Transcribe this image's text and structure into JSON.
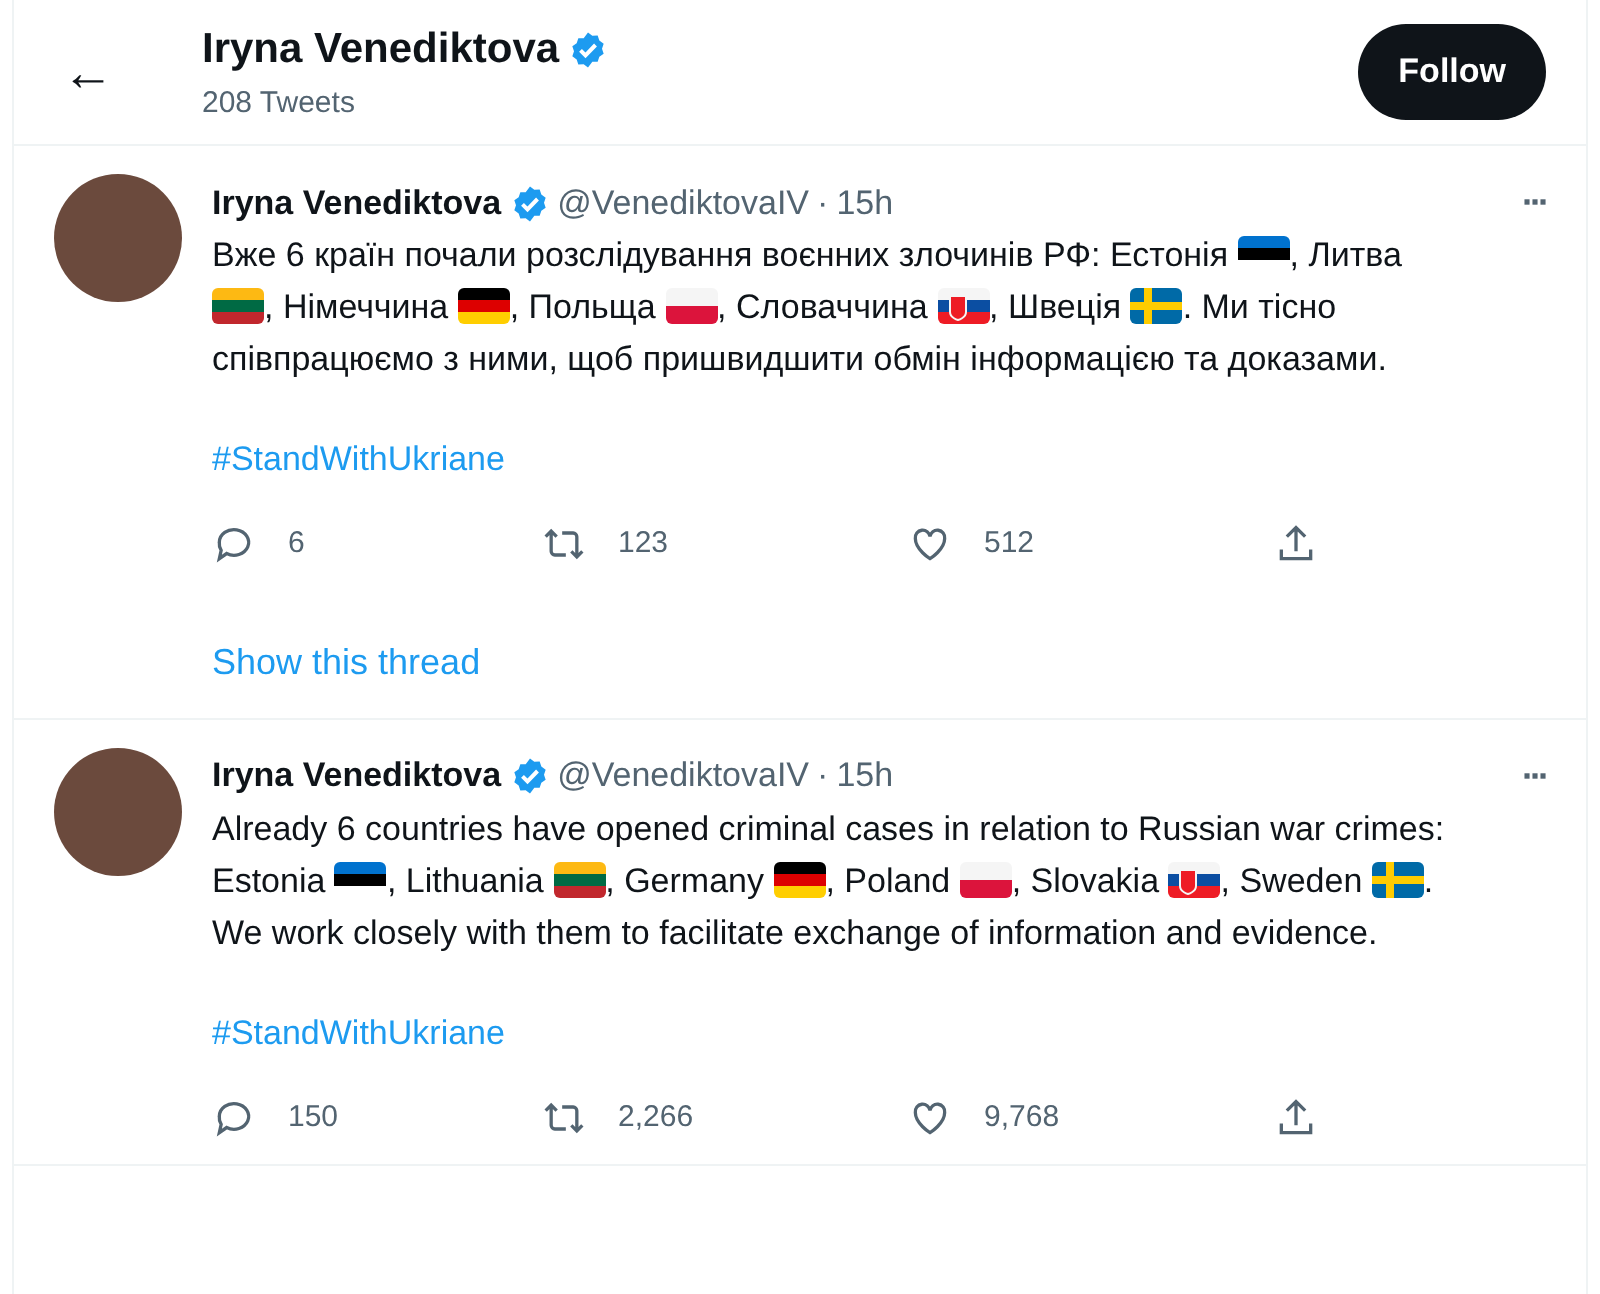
{
  "header": {
    "back": "←",
    "name": "Iryna Venediktova",
    "verified": true,
    "count": "208 Tweets",
    "follow": "Follow"
  },
  "tweets": [
    {
      "name": "Iryna Venediktova",
      "verified": true,
      "handle": "@VenediktovaIV",
      "dot": "·",
      "time": "15h",
      "more": "···",
      "body": [
        {
          "kind": "text",
          "text": "Вже 6 країн почали розслідування воєнних злочинів РФ: Естонія "
        },
        {
          "kind": "tricolor",
          "stripes": [
            {
              "color": "#0072ce"
            },
            {
              "color": "#000000"
            },
            {
              "color": "#ffffff"
            }
          ]
        },
        {
          "kind": "text",
          "text": ", Литва "
        },
        {
          "kind": "tricolor",
          "stripes": [
            {
              "color": "#fdb913"
            },
            {
              "color": "#006a44"
            },
            {
              "color": "#c1272d"
            }
          ]
        },
        {
          "kind": "text",
          "text": ", Німеччина "
        },
        {
          "kind": "tricolor",
          "stripes": [
            {
              "color": "#000000"
            },
            {
              "color": "#dd0000"
            },
            {
              "color": "#ffce00"
            }
          ]
        },
        {
          "kind": "text",
          "text": ", Польща "
        },
        {
          "kind": "bicolor",
          "stripes": [
            {
              "color": "#f5f5f5"
            },
            {
              "color": "#dc143c"
            }
          ]
        },
        {
          "kind": "text",
          "text": ", Словаччина "
        },
        {
          "kind": "emblem",
          "stripes": [
            {
              "color": "#f5f5f5"
            },
            {
              "color": "#0b4ea2"
            },
            {
              "color": "#ee1c25"
            }
          ]
        },
        {
          "kind": "text",
          "text": ", Швеція "
        },
        {
          "kind": "cross",
          "stripes": [
            {
              "color": "#006aa7"
            },
            {
              "color": "#fecc00"
            }
          ]
        },
        {
          "kind": "text",
          "text": ". Ми тісно співпрацюємо з ними, щоб пришвидшити обмін інформацією та доказами."
        }
      ],
      "hashtag": "#StandWithUkriane",
      "replies": "6",
      "retweets": "123",
      "likes": "512",
      "thread": "Show this thread"
    },
    {
      "name": "Iryna Venediktova",
      "verified": true,
      "handle": "@VenediktovaIV",
      "dot": "·",
      "time": "15h",
      "more": "···",
      "body": [
        {
          "kind": "text",
          "text": "Already 6 countries have opened criminal cases in relation to Russian war crimes: Estonia "
        },
        {
          "kind": "tricolor",
          "stripes": [
            {
              "color": "#0072ce"
            },
            {
              "color": "#000000"
            },
            {
              "color": "#ffffff"
            }
          ]
        },
        {
          "kind": "text",
          "text": ", Lithuania "
        },
        {
          "kind": "tricolor",
          "stripes": [
            {
              "color": "#fdb913"
            },
            {
              "color": "#006a44"
            },
            {
              "color": "#c1272d"
            }
          ]
        },
        {
          "kind": "text",
          "text": ", Germany "
        },
        {
          "kind": "tricolor",
          "stripes": [
            {
              "color": "#000000"
            },
            {
              "color": "#dd0000"
            },
            {
              "color": "#ffce00"
            }
          ]
        },
        {
          "kind": "text",
          "text": ", Poland "
        },
        {
          "kind": "bicolor",
          "stripes": [
            {
              "color": "#f5f5f5"
            },
            {
              "color": "#dc143c"
            }
          ]
        },
        {
          "kind": "text",
          "text": ", Slovakia "
        },
        {
          "kind": "emblem",
          "stripes": [
            {
              "color": "#f5f5f5"
            },
            {
              "color": "#0b4ea2"
            },
            {
              "color": "#ee1c25"
            }
          ]
        },
        {
          "kind": "text",
          "text": ", Sweden "
        },
        {
          "kind": "cross",
          "stripes": [
            {
              "color": "#006aa7"
            },
            {
              "color": "#fecc00"
            }
          ]
        },
        {
          "kind": "text",
          "text": ". We work closely with them to facilitate exchange of information and evidence."
        }
      ],
      "hashtag": "#StandWithUkriane",
      "replies": "150",
      "retweets": "2,266",
      "likes": "9,768"
    }
  ]
}
